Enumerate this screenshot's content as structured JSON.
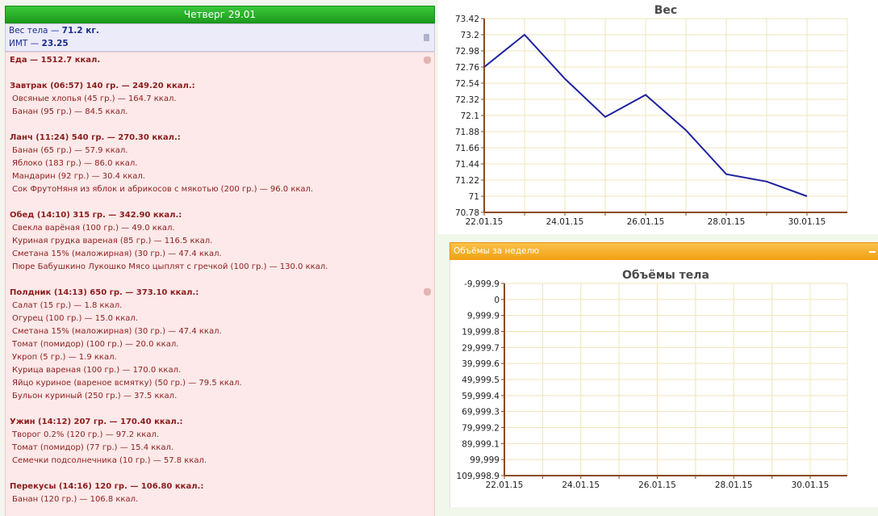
{
  "day": {
    "header": "Четверг 29.01"
  },
  "weight": {
    "line1_prefix": "Вес тела — ",
    "line1_value": "71.2 кг.",
    "line2_prefix": "ИМТ — ",
    "line2_value": "23.25"
  },
  "food": {
    "lines": [
      {
        "text": "Еда — 1512.7 ккал.",
        "bold": true,
        "indent": false
      },
      {
        "text": "Завтрак (06:57) 140 гр. — 249.20 ккал.:",
        "bold": true,
        "indent": false
      },
      {
        "text": "Овсяные хлопья (45 гр.) — 164.7 ккал.",
        "bold": false,
        "indent": true
      },
      {
        "text": "Банан (95 гр.) — 84.5 ккал.",
        "bold": false,
        "indent": true
      },
      {
        "text": "Ланч (11:24) 540 гр. — 270.30 ккал.:",
        "bold": true,
        "indent": false
      },
      {
        "text": "Банан (65 гр.) — 57.9 ккал.",
        "bold": false,
        "indent": true
      },
      {
        "text": "Яблоко (183 гр.) — 86.0 ккал.",
        "bold": false,
        "indent": true
      },
      {
        "text": "Мандарин (92 гр.) — 30.4 ккал.",
        "bold": false,
        "indent": true
      },
      {
        "text": "Сок ФрутоНяня из яблок и абрикосов с мякотью (200 гр.) — 96.0 ккал.",
        "bold": false,
        "indent": true
      },
      {
        "text": "Обед (14:10) 315 гр. — 342.90 ккал.:",
        "bold": true,
        "indent": false
      },
      {
        "text": "Свекла варёная (100 гр.) — 49.0 ккал.",
        "bold": false,
        "indent": true
      },
      {
        "text": "Куриная грудка вареная (85 гр.) — 116.5 ккал.",
        "bold": false,
        "indent": true
      },
      {
        "text": "Сметана 15% (маложирная) (30 гр.) — 47.4 ккал.",
        "bold": false,
        "indent": true
      },
      {
        "text": "Пюре Бабушкино Лукошко Мясо цыплят с гречкой (100 гр.) — 130.0 ккал.",
        "bold": false,
        "indent": true
      },
      {
        "text": "Полдник (14:13) 650 гр. — 373.10 ккал.:",
        "bold": true,
        "indent": false
      },
      {
        "text": "Салат (15 гр.) — 1.8 ккал.",
        "bold": false,
        "indent": true
      },
      {
        "text": "Огурец (100 гр.) — 15.0 ккал.",
        "bold": false,
        "indent": true
      },
      {
        "text": "Сметана 15% (маложирная) (30 гр.) — 47.4 ккал.",
        "bold": false,
        "indent": true
      },
      {
        "text": "Томат (помидор) (100 гр.) — 20.0 ккал.",
        "bold": false,
        "indent": true
      },
      {
        "text": "Укроп (5 гр.) — 1.9 ккал.",
        "bold": false,
        "indent": true
      },
      {
        "text": "Курица вареная (100 гр.) — 170.0 ккал.",
        "bold": false,
        "indent": true
      },
      {
        "text": "Яйцо куриное (вареное всмятку) (50 гр.) — 79.5 ккал.",
        "bold": false,
        "indent": true
      },
      {
        "text": "Бульон куриный (250 гр.) — 37.5 ккал.",
        "bold": false,
        "indent": true
      },
      {
        "text": "Ужин (14:12) 207 гр. — 170.40 ккал.:",
        "bold": true,
        "indent": false
      },
      {
        "text": "Творог 0.2% (120 гр.) — 97.2 ккал.",
        "bold": false,
        "indent": true
      },
      {
        "text": "Томат (помидор) (77 гр.) — 15.4 ккал.",
        "bold": false,
        "indent": true
      },
      {
        "text": "Семечки подсолнечника (10 гр.) — 57.8 ккал.",
        "bold": false,
        "indent": true
      },
      {
        "text": "Перекусы (14:16) 120 гр. — 106.80 ккал.:",
        "bold": true,
        "indent": false
      },
      {
        "text": "Банан (120 гр.) — 106.8 ккал.",
        "bold": false,
        "indent": true
      }
    ]
  },
  "volumes_panel": {
    "title": "Объёмы за неделю"
  },
  "icons": [
    "trash-icon",
    "hand-icon",
    "minus-icon"
  ],
  "colors": {
    "header_green": "#1c9a1c",
    "weight_text": "#1c2e8c",
    "food_text": "#8c1d1d",
    "line_color": "#1e22a0",
    "panel_orange": "#f1a012",
    "grid_color": "#f0e3b8",
    "axis_color": "#8b4a1a"
  },
  "chart_data": [
    {
      "type": "line",
      "title": "Вес",
      "x": [
        "22.01.15",
        "23.01.15",
        "24.01.15",
        "25.01.15",
        "26.01.15",
        "27.01.15",
        "28.01.15",
        "29.01.15",
        "30.01.15"
      ],
      "y": [
        72.76,
        73.2,
        72.6,
        72.08,
        72.38,
        71.9,
        71.3,
        71.2,
        71.0
      ],
      "x_tick_labels": [
        "22.01.15",
        "24.01.15",
        "26.01.15",
        "28.01.15",
        "30.01.15"
      ],
      "y_tick_labels": [
        "73.42",
        "73.2",
        "72.98",
        "72.76",
        "72.54",
        "72.32",
        "72.1",
        "71.88",
        "71.66",
        "71.44",
        "71.22",
        "71",
        "70.78"
      ],
      "ylim": [
        70.78,
        73.42
      ],
      "grid": true,
      "legend": "none"
    },
    {
      "type": "line",
      "title": "Объёмы тела",
      "series": [],
      "x_tick_labels": [
        "22.01.15",
        "24.01.15",
        "26.01.15",
        "28.01.15",
        "30.01.15"
      ],
      "y_tick_labels": [
        "-9,999.9",
        "0",
        "9,999.9",
        "19,999.8",
        "29,999.7",
        "39,999.6",
        "49,999.5",
        "59,999.4",
        "69,999.3",
        "79,999.2",
        "89,999.1",
        "99,999",
        "109,998.9"
      ],
      "grid": true,
      "legend": "none"
    }
  ]
}
